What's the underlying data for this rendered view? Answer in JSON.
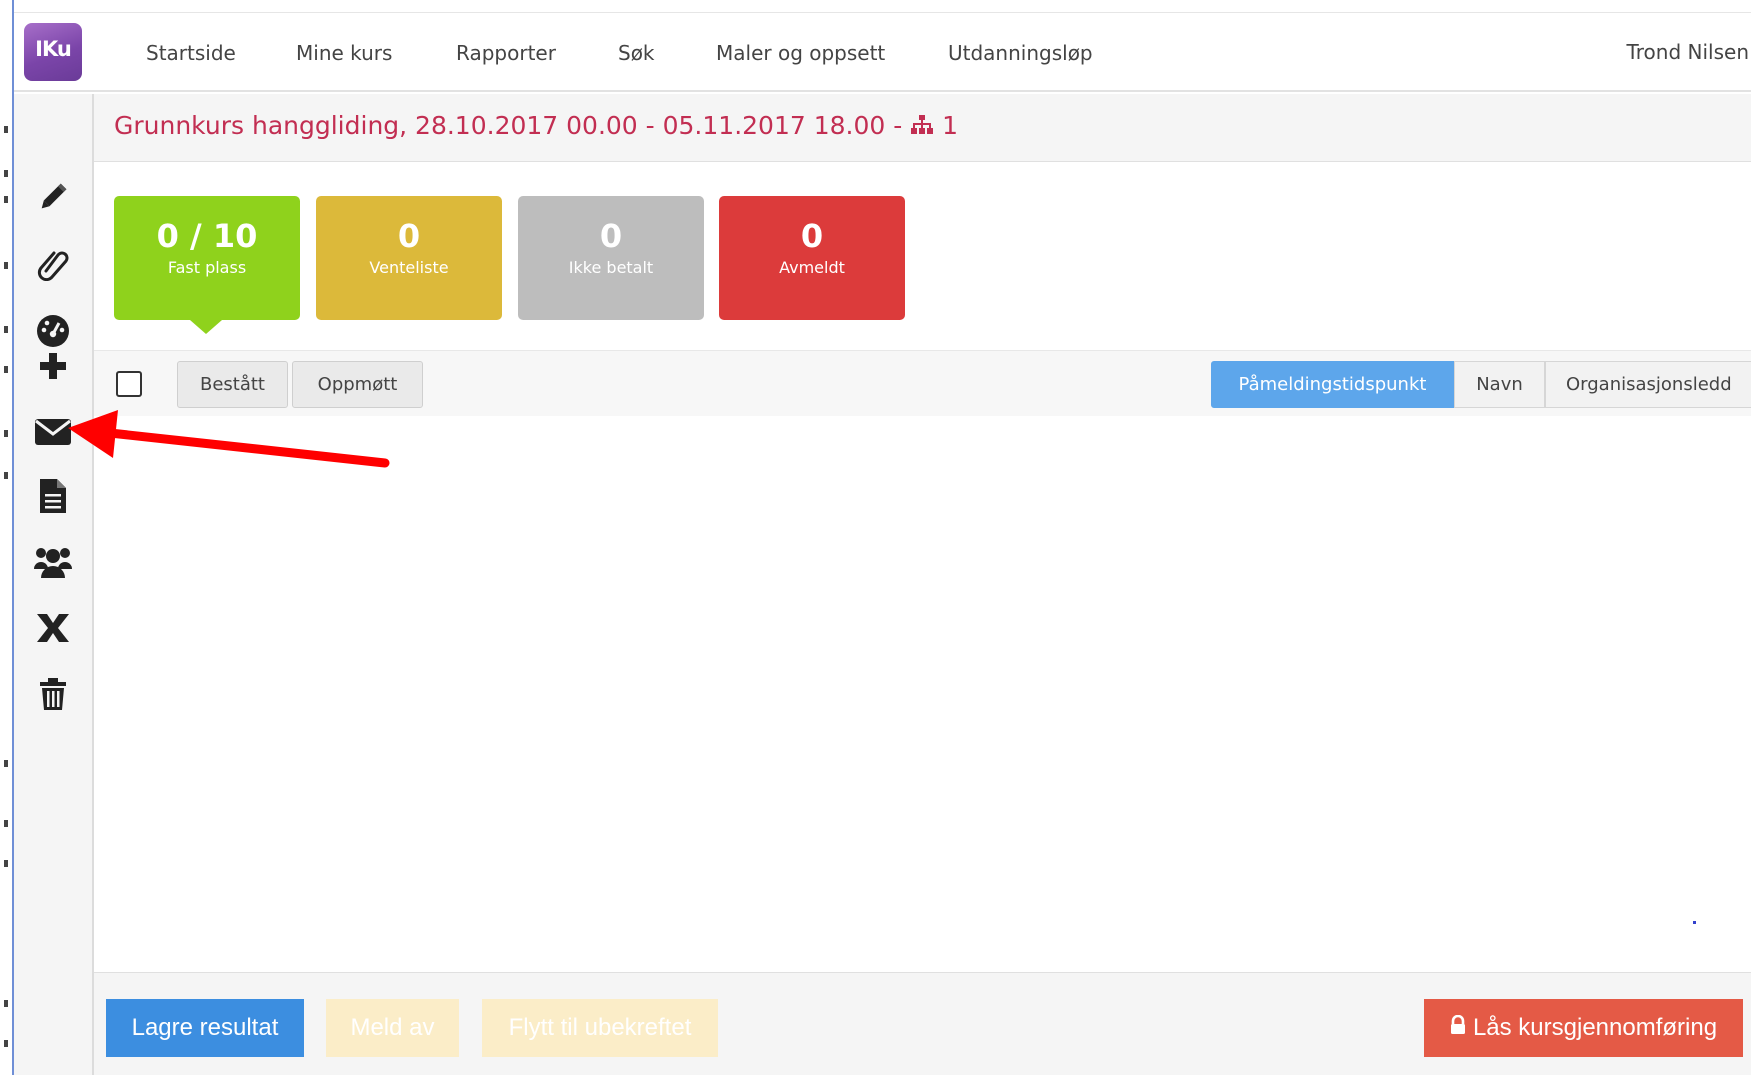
{
  "app": {
    "logo_text": "IKu",
    "brand_color": "#7b45a9"
  },
  "nav": {
    "items": [
      "Startside",
      "Mine kurs",
      "Rapporter",
      "Søk",
      "Maler og oppsett",
      "Utdanningsløp"
    ],
    "user": "Trond Nilsen"
  },
  "sidebar": {
    "icons": [
      "pencil-icon",
      "paperclip-icon",
      "dashboard-icon",
      "plus-icon",
      "envelope-icon",
      "document-icon",
      "users-icon",
      "excel-icon",
      "trash-icon"
    ]
  },
  "course": {
    "title": "Grunnkurs hanggliding, 28.10.2017 00.00 - 05.11.2017 18.00 - ",
    "org_icon": "sitemap-icon",
    "org_count": "1",
    "title_color": "#c22e52"
  },
  "stats": [
    {
      "value": "0 / 10",
      "label": "Fast plass",
      "color": "#8fd21c"
    },
    {
      "value": "0",
      "label": "Venteliste",
      "color": "#dcb93a"
    },
    {
      "value": "0",
      "label": "Ikke betalt",
      "color": "#bdbdbd"
    },
    {
      "value": "0",
      "label": "Avmeldt",
      "color": "#dc3b3b"
    }
  ],
  "toolbar": {
    "passed_label": "Bestått",
    "attended_label": "Oppmøtt",
    "sort_options": [
      "Påmeldingstidspunkt",
      "Navn",
      "Organisasjonsledd"
    ],
    "sort_selected": "Påmeldingstidspunkt"
  },
  "footer": {
    "save_label": "Lagre resultat",
    "unregister_label": "Meld av",
    "move_label": "Flytt til ubekreftet",
    "lock_label": "Lås kursgjennomføring",
    "lock_icon": "lock-icon"
  },
  "annotation": {
    "arrow_color": "#ff0000"
  }
}
